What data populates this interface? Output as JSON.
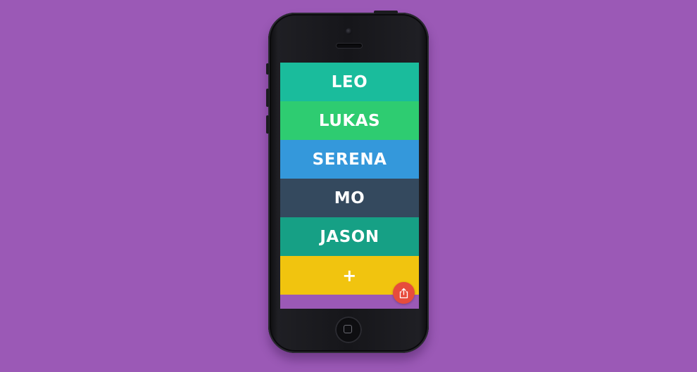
{
  "app": {
    "rows": [
      {
        "label": "LEO",
        "color": "#1abc9c"
      },
      {
        "label": "LUKAS",
        "color": "#2ecc71"
      },
      {
        "label": "SERENA",
        "color": "#3498db"
      },
      {
        "label": "MO",
        "color": "#34495e"
      },
      {
        "label": "JASON",
        "color": "#16a085"
      }
    ],
    "add_row": {
      "label": "+",
      "color": "#f1c40f"
    },
    "share_button": {
      "icon": "share-icon",
      "color": "#e74c3c"
    },
    "screen_background": "#9b59b6"
  },
  "page": {
    "background": "#9b59b6"
  }
}
